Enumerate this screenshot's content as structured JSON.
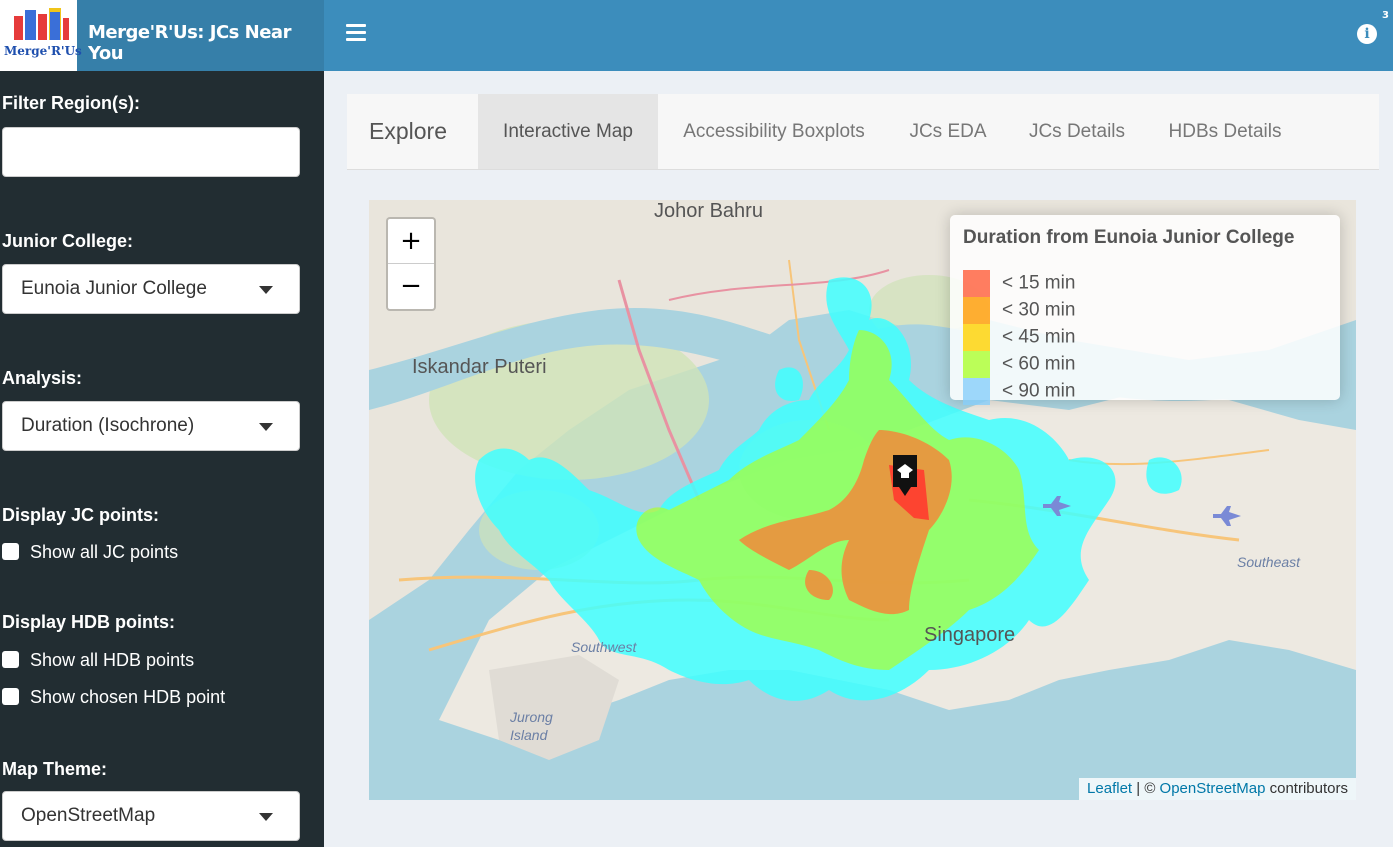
{
  "header": {
    "logo_text": "Merge'R'Us",
    "app_title": "Merge'R'Us: JCs Near You",
    "info_badge": "3"
  },
  "sidebar": {
    "filter_region_label": "Filter Region(s):",
    "filter_region_value": "",
    "junior_college_label": "Junior College:",
    "junior_college_value": "Eunoia Junior College",
    "analysis_label": "Analysis:",
    "analysis_value": "Duration (Isochrone)",
    "display_jc_label": "Display JC points:",
    "show_all_jc": "Show all JC points",
    "display_hdb_label": "Display HDB points:",
    "show_all_hdb": "Show all HDB points",
    "show_chosen_hdb": "Show chosen HDB point",
    "map_theme_label": "Map Theme:",
    "map_theme_value": "OpenStreetMap"
  },
  "tabs": {
    "title": "Explore",
    "items": [
      "Interactive Map",
      "Accessibility Boxplots",
      "JCs EDA",
      "JCs Details",
      "HDBs Details"
    ],
    "active": 0
  },
  "map": {
    "zoom_in": "+",
    "zoom_out": "−",
    "legend": {
      "title": "Duration from Eunoia Junior College",
      "items": [
        {
          "label": "< 15 min",
          "color": "#ff5e3a"
        },
        {
          "label": "< 30 min",
          "color": "#ff9b00"
        },
        {
          "label": "< 45 min",
          "color": "#ffd200"
        },
        {
          "label": "< 60 min",
          "color": "#adff2f"
        },
        {
          "label": "< 90 min",
          "color": "#87cefa"
        }
      ]
    },
    "labels": {
      "johor_bahru": "Johor Bahru",
      "iskandar_puteri": "Iskandar Puteri",
      "singapore": "Singapore",
      "southwest": "Southwest",
      "jurong_island": "Jurong Island",
      "southeast": "Southeast"
    },
    "attribution": {
      "leaflet": "Leaflet",
      "separator": " | © ",
      "osm": "OpenStreetMap",
      "suffix": " contributors"
    }
  }
}
